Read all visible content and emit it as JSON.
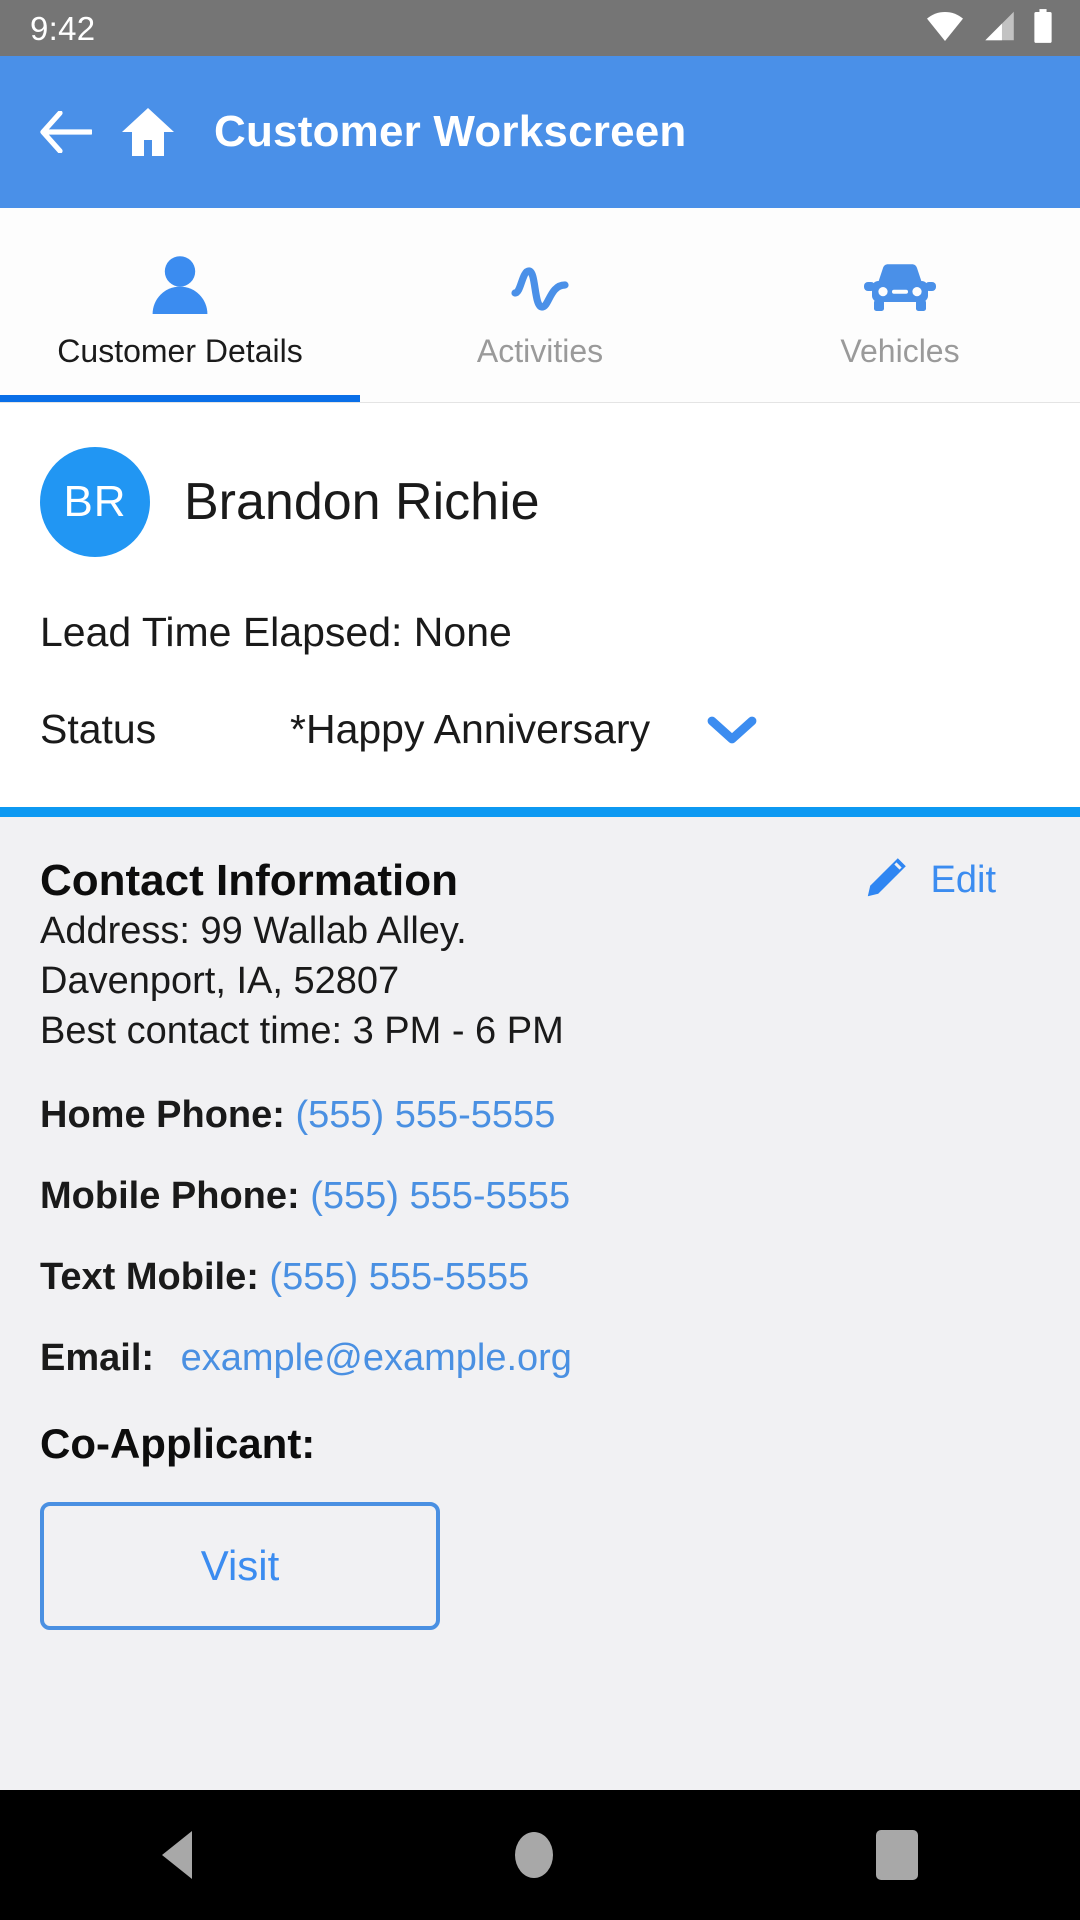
{
  "status_bar": {
    "time": "9:42",
    "icons": [
      "wifi-icon",
      "cellular-signal-icon",
      "battery-icon"
    ]
  },
  "app_bar": {
    "title": "Customer Workscreen",
    "back_icon": "arrow-left-icon",
    "home_icon": "home-icon",
    "background_color": "#4a90e8"
  },
  "tabs": [
    {
      "label": "Customer Details",
      "icon": "person-icon",
      "active": true
    },
    {
      "label": "Activities",
      "icon": "activity-pulse-icon",
      "active": false
    },
    {
      "label": "Vehicles",
      "icon": "car-icon",
      "active": false
    }
  ],
  "customer": {
    "initials": "BR",
    "name": "Brandon Richie",
    "lead_time": "Lead Time Elapsed: None",
    "status_label": "Status",
    "status_value": "*Happy Anniversary",
    "status_caret_icon": "chevron-down-icon"
  },
  "contact": {
    "title": "Contact Information",
    "edit_label": "Edit",
    "edit_icon": "pencil-icon",
    "address_line_1": "Address: 99 Wallab Alley.",
    "address_line_2": "Davenport, IA, 52807",
    "best_contact_time": "Best contact time: 3 PM - 6 PM",
    "home_phone_label": "Home Phone:",
    "home_phone_value": "(555) 555-5555",
    "mobile_phone_label": "Mobile Phone:",
    "mobile_phone_value": "(555) 555-5555",
    "text_mobile_label": "Text Mobile:",
    "text_mobile_value": "(555) 555-5555",
    "email_label": "Email:",
    "email_value": "example@example.org",
    "coapplicant_label": "Co-Applicant:",
    "visit_button": "Visit"
  },
  "nav_bar": {
    "back_icon": "triangle-back-icon",
    "home_icon": "circle-home-icon",
    "recents_icon": "square-recents-icon"
  },
  "colors": {
    "accent_blue": "#4a90e8",
    "link_blue": "#4a90e2",
    "divider_blue": "#0d99f2",
    "tab_underline": "#0a6fe8",
    "avatar_blue": "#2196f3",
    "card_bg": "#f1f1f3",
    "status_bar_gray": "#757575"
  }
}
